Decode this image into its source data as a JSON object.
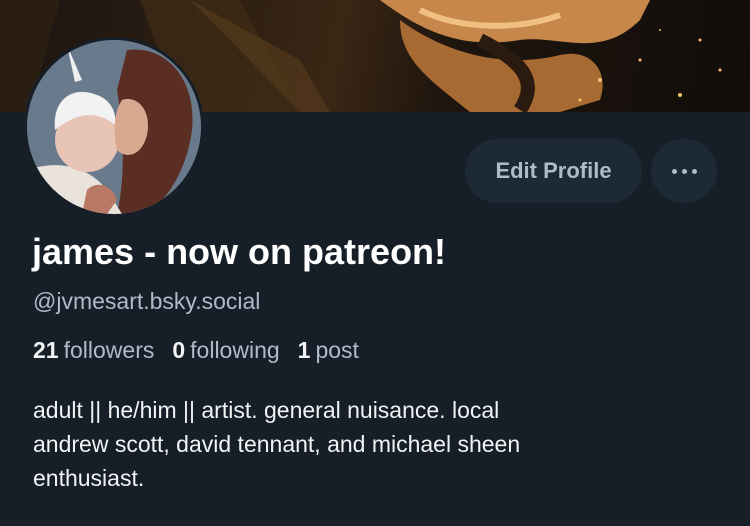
{
  "profile": {
    "display_name": "james - now on patreon!",
    "handle": "@jvmesart.bsky.social",
    "bio_lines": [
      "adult || he/him || artist. general nuisance. local",
      "andrew scott, david tennant, and michael sheen",
      "enthusiast."
    ]
  },
  "stats": {
    "followers_count": "21",
    "followers_label": "followers",
    "following_count": "0",
    "following_label": "following",
    "posts_count": "1",
    "posts_label": "post"
  },
  "actions": {
    "edit_profile_label": "Edit Profile",
    "more_icon": "ellipsis-icon"
  },
  "colors": {
    "background": "#161e27",
    "button_bg": "#1e2936",
    "muted_text": "#aebbc9"
  }
}
